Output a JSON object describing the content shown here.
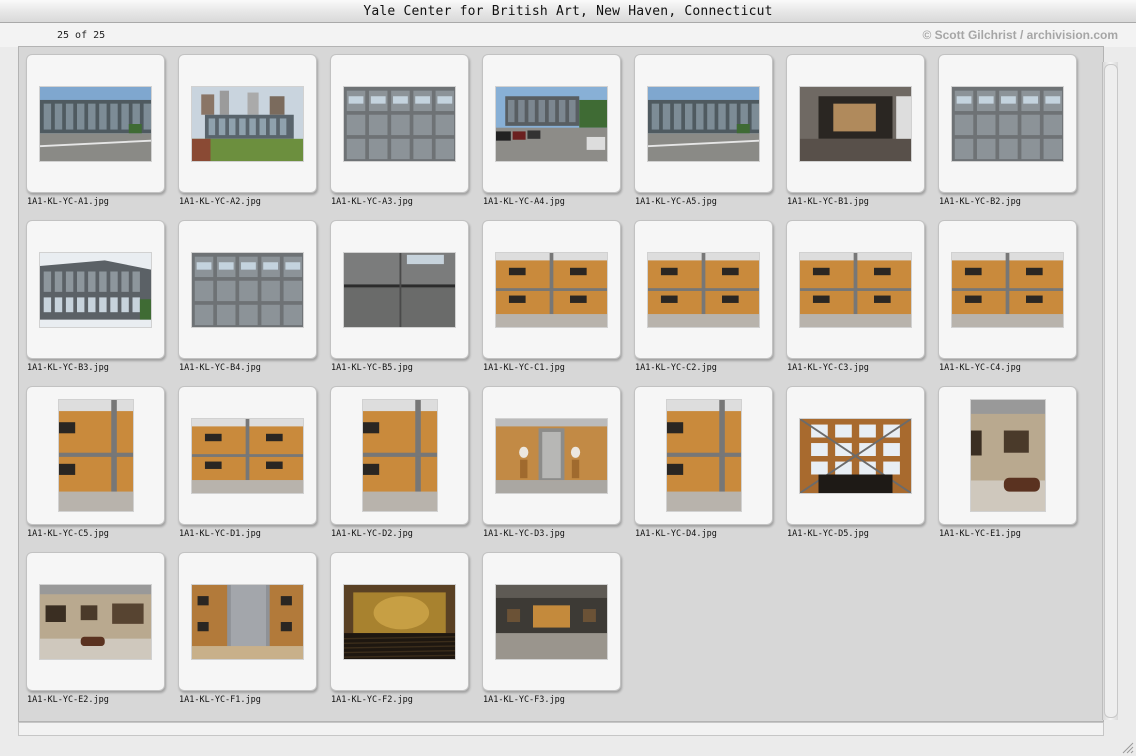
{
  "window": {
    "title": "Yale Center for British Art, New Haven, Connecticut"
  },
  "info": {
    "count": "25 of 25",
    "credit": "© Scott Gilchrist / archivision.com"
  },
  "images": [
    {
      "filename": "1A1-KL-YC-A1.jpg",
      "orientation": "landscape",
      "scene": "exterior-street"
    },
    {
      "filename": "1A1-KL-YC-A2.jpg",
      "orientation": "landscape",
      "scene": "exterior-aerial"
    },
    {
      "filename": "1A1-KL-YC-A3.jpg",
      "orientation": "landscape",
      "scene": "facade-panels"
    },
    {
      "filename": "1A1-KL-YC-A4.jpg",
      "orientation": "landscape",
      "scene": "exterior-cars"
    },
    {
      "filename": "1A1-KL-YC-A5.jpg",
      "orientation": "landscape",
      "scene": "exterior-street"
    },
    {
      "filename": "1A1-KL-YC-B1.jpg",
      "orientation": "landscape",
      "scene": "entrance-dark"
    },
    {
      "filename": "1A1-KL-YC-B2.jpg",
      "orientation": "landscape",
      "scene": "facade-panels"
    },
    {
      "filename": "1A1-KL-YC-B3.jpg",
      "orientation": "landscape",
      "scene": "exterior-corner"
    },
    {
      "filename": "1A1-KL-YC-B4.jpg",
      "orientation": "landscape",
      "scene": "facade-panels"
    },
    {
      "filename": "1A1-KL-YC-B5.jpg",
      "orientation": "landscape",
      "scene": "facade-detail"
    },
    {
      "filename": "1A1-KL-YC-C1.jpg",
      "orientation": "landscape",
      "scene": "court-wood"
    },
    {
      "filename": "1A1-KL-YC-C2.jpg",
      "orientation": "landscape",
      "scene": "court-wood"
    },
    {
      "filename": "1A1-KL-YC-C3.jpg",
      "orientation": "landscape",
      "scene": "court-wood"
    },
    {
      "filename": "1A1-KL-YC-C4.jpg",
      "orientation": "landscape",
      "scene": "court-wood"
    },
    {
      "filename": "1A1-KL-YC-C5.jpg",
      "orientation": "portrait",
      "scene": "court-wood"
    },
    {
      "filename": "1A1-KL-YC-D1.jpg",
      "orientation": "landscape",
      "scene": "court-wood"
    },
    {
      "filename": "1A1-KL-YC-D2.jpg",
      "orientation": "portrait",
      "scene": "court-wood"
    },
    {
      "filename": "1A1-KL-YC-D3.jpg",
      "orientation": "landscape",
      "scene": "gallery-busts"
    },
    {
      "filename": "1A1-KL-YC-D4.jpg",
      "orientation": "portrait",
      "scene": "court-wood"
    },
    {
      "filename": "1A1-KL-YC-D5.jpg",
      "orientation": "landscape",
      "scene": "skylight"
    },
    {
      "filename": "1A1-KL-YC-E1.jpg",
      "orientation": "portrait",
      "scene": "gallery-room"
    },
    {
      "filename": "1A1-KL-YC-E2.jpg",
      "orientation": "landscape",
      "scene": "gallery-room"
    },
    {
      "filename": "1A1-KL-YC-F1.jpg",
      "orientation": "landscape",
      "scene": "cylinder-stair"
    },
    {
      "filename": "1A1-KL-YC-F2.jpg",
      "orientation": "landscape",
      "scene": "auditorium"
    },
    {
      "filename": "1A1-KL-YC-F3.jpg",
      "orientation": "landscape",
      "scene": "gallery-dark"
    }
  ]
}
